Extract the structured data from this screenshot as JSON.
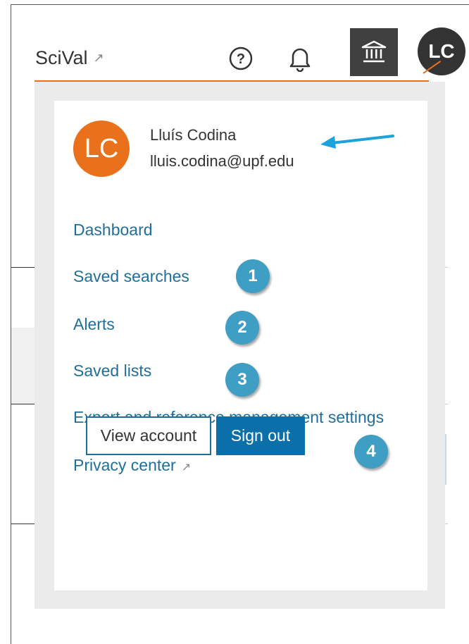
{
  "header": {
    "brand_label": "SciVal",
    "brand_external_icon": "external-link-icon",
    "help_icon": "help-circle-icon",
    "notifications_icon": "bell-icon",
    "institution_icon": "institution-icon",
    "avatar_initials": "LC"
  },
  "profile": {
    "avatar_initials": "LC",
    "name": "Lluís Codina",
    "email": "lluis.codina@upf.edu"
  },
  "menu": {
    "items": [
      {
        "label": "Dashboard"
      },
      {
        "label": "Saved searches"
      },
      {
        "label": "Alerts"
      },
      {
        "label": "Saved lists"
      },
      {
        "label": "Export and reference management settings"
      },
      {
        "label": "Privacy center"
      }
    ]
  },
  "annotations": {
    "badges": [
      "1",
      "2",
      "3",
      "4"
    ]
  },
  "actions": {
    "view_account_label": "View account",
    "sign_out_label": "Sign out"
  },
  "colors": {
    "accent_orange": "#e9711c",
    "link_blue": "#1f6f9a",
    "primary_button": "#0b70a9",
    "badge_blue": "#3f9ec4",
    "annotation_arrow": "#1ba3dc"
  }
}
